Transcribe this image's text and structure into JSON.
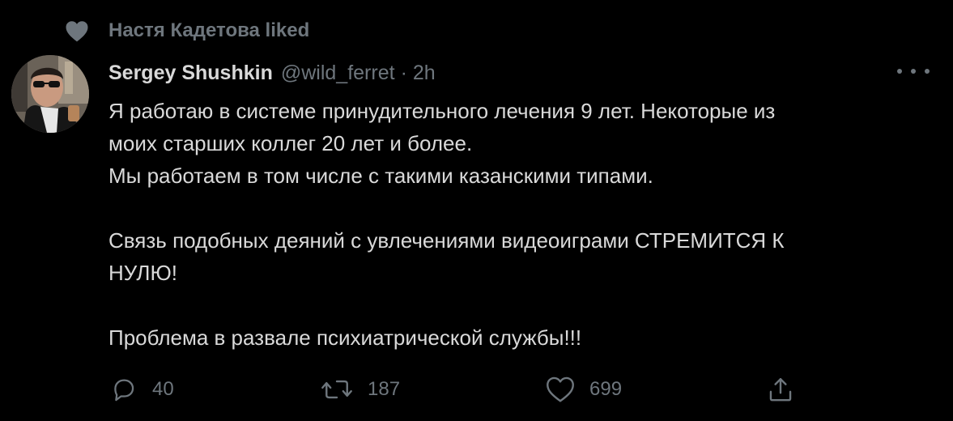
{
  "social_context": {
    "icon": "heart-icon",
    "text": "Настя Кадетова liked"
  },
  "tweet": {
    "author": {
      "display_name": "Sergey Shushkin",
      "handle": "@wild_ferret",
      "avatar": "avatar"
    },
    "separator": "·",
    "timestamp": "2h",
    "more_icon": "more-horizontal-icon",
    "text": {
      "line1": "Я работаю в системе принудительного лечения 9 лет. Некоторые из",
      "line2": "моих старших коллег 20 лет и более.",
      "line3": "Мы работаем в том числе с такими казанскими типами.",
      "line4": "Связь подобных деяний с увлечениями видеоиграми СТРЕМИТСЯ К",
      "line5": "НУЛЮ!",
      "line6": "Проблема в развале психиатрической службы!!!"
    },
    "actions": {
      "reply": {
        "icon": "reply-icon",
        "count": "40"
      },
      "retweet": {
        "icon": "retweet-icon",
        "count": "187"
      },
      "like": {
        "icon": "like-icon",
        "count": "699"
      },
      "share": {
        "icon": "share-icon"
      }
    }
  },
  "colors": {
    "background": "#000000",
    "primary_text": "#d9d9d9",
    "secondary_text": "#6e767d"
  }
}
